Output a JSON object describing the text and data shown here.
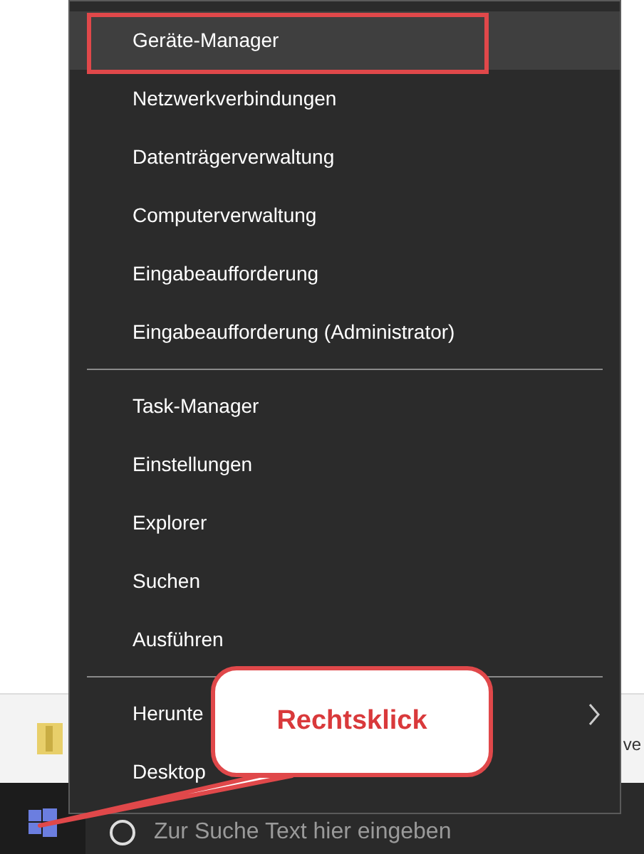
{
  "menu": {
    "groups": [
      [
        {
          "label": "Geräte-Manager",
          "selected": true,
          "submenu": false
        },
        {
          "label": "Netzwerkverbindungen",
          "selected": false,
          "submenu": false
        },
        {
          "label": "Datenträgerverwaltung",
          "selected": false,
          "submenu": false
        },
        {
          "label": "Computerverwaltung",
          "selected": false,
          "submenu": false
        },
        {
          "label": "Eingabeaufforderung",
          "selected": false,
          "submenu": false
        },
        {
          "label": "Eingabeaufforderung (Administrator)",
          "selected": false,
          "submenu": false
        }
      ],
      [
        {
          "label": "Task-Manager",
          "selected": false,
          "submenu": false
        },
        {
          "label": "Einstellungen",
          "selected": false,
          "submenu": false
        },
        {
          "label": "Explorer",
          "selected": false,
          "submenu": false
        },
        {
          "label": "Suchen",
          "selected": false,
          "submenu": false
        },
        {
          "label": "Ausführen",
          "selected": false,
          "submenu": false
        }
      ],
      [
        {
          "label": "Herunte",
          "selected": false,
          "submenu": true
        },
        {
          "label": "Desktop",
          "selected": false,
          "submenu": false
        }
      ]
    ]
  },
  "background_window": {
    "text": "ve"
  },
  "callout": {
    "text": "Rechtsklick"
  },
  "taskbar": {
    "search": {
      "placeholder": "Zur Suche Text hier eingeben"
    }
  }
}
